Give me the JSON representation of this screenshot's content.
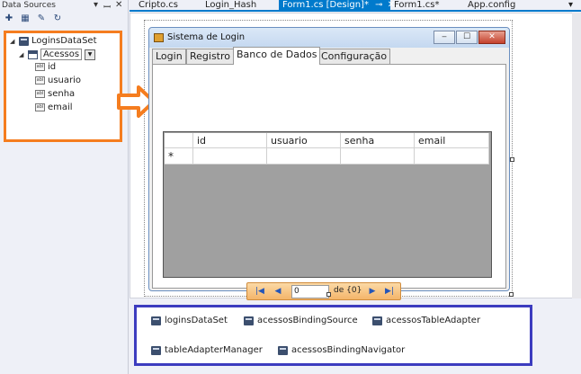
{
  "data_sources": {
    "title": "Data Sources",
    "pin_glyph": "▾ ꟷ ✕",
    "toolbar_icons": [
      "add-datasource-icon",
      "edit-dataset-icon",
      "configure-icon",
      "refresh-icon"
    ],
    "tree": {
      "dataset": "LoginsDataSet",
      "table": "Acessos",
      "fields": [
        "id",
        "usuario",
        "senha",
        "email"
      ]
    },
    "highlight_color": "#f57d1f"
  },
  "tabs": [
    {
      "label": "Cripto.cs",
      "active": false
    },
    {
      "label": "Login_Hash",
      "active": false
    },
    {
      "label": "Form1.cs [Design]*",
      "active": true
    },
    {
      "label": "Form1.cs*",
      "active": false
    },
    {
      "label": "App.config",
      "active": false
    }
  ],
  "form": {
    "title": "Sistema de Login",
    "tabs": [
      "Login",
      "Registro",
      "Banco de Dados",
      "Configuração"
    ],
    "active_tab": "Banco de Dados",
    "grid": {
      "columns": [
        "id",
        "usuario",
        "senha",
        "email"
      ],
      "new_row_marker": "*"
    },
    "navigator": {
      "position_value": "0",
      "count_text": "de {0}"
    }
  },
  "tray": {
    "components": [
      "loginsDataSet",
      "acessosBindingSource",
      "acessosTableAdapter",
      "tableAdapterManager",
      "acessosBindingNavigator"
    ],
    "border_color": "#3c3cbf"
  },
  "accent_color": "#007acc"
}
